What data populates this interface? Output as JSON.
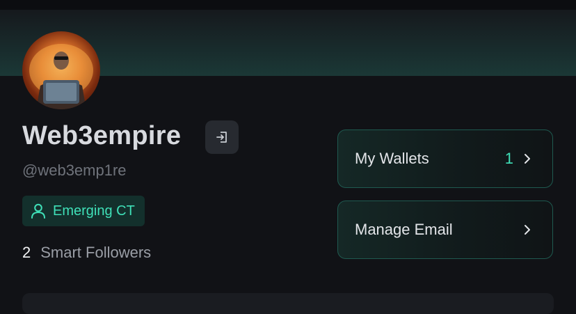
{
  "profile": {
    "display_name": "Web3empire",
    "handle": "@web3emp1re",
    "badge_label": "Emerging CT",
    "smart_followers_count": "2",
    "smart_followers_label": "Smart Followers"
  },
  "actions": {
    "wallets_label": "My Wallets",
    "wallets_count": "1",
    "email_label": "Manage Email"
  },
  "icons": {
    "logout": "logout-icon",
    "user": "user-icon",
    "chevron": "chevron-right-icon"
  },
  "colors": {
    "accent": "#3fe0b8",
    "background": "#111216",
    "card_border": "#1f5a50"
  }
}
